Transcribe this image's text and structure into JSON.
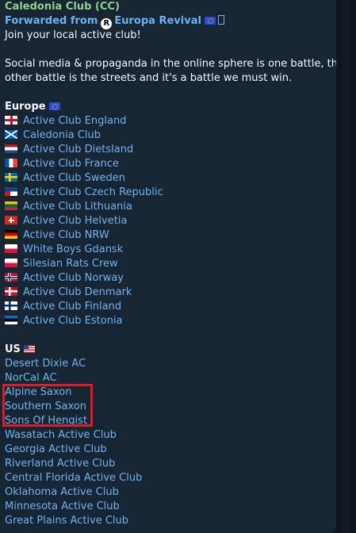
{
  "message": {
    "sender": "Caledonia Club (CC)",
    "forwarded_prefix": "Forwarded from",
    "forwarded_channel": "Europa Revival",
    "intro": "Join your local active club!",
    "paragraph_line1": "Social media & propaganda in the online sphere is one battle, the",
    "paragraph_line2": "other battle is the streets and it's a battle we must win.",
    "europe_heading": "Europe",
    "europe_clubs": [
      {
        "name": "Active Club England",
        "flag": "england-flag-icon",
        "colors": [
          "#ffffff",
          "#ce1124"
        ]
      },
      {
        "name": "Caledonia Club",
        "flag": "scotland-flag-icon",
        "colors": [
          "#005eb8",
          "#ffffff"
        ]
      },
      {
        "name": "Active Club Dietsland",
        "flag": "netherlands-flag-icon",
        "colors": [
          "#ae1c28",
          "#ffffff",
          "#21468b"
        ]
      },
      {
        "name": "Active Club France",
        "flag": "france-flag-icon",
        "colors": [
          "#0055a4",
          "#ffffff",
          "#ef4135"
        ]
      },
      {
        "name": "Active Club Sweden",
        "flag": "sweden-flag-icon",
        "colors": [
          "#006aa7",
          "#fecc00"
        ]
      },
      {
        "name": "Active Club Czech Republic",
        "flag": "czech-flag-icon",
        "colors": [
          "#ffffff",
          "#d7141a",
          "#11457e"
        ]
      },
      {
        "name": "Active Club Lithuania",
        "flag": "lithuania-flag-icon",
        "colors": [
          "#fdb913",
          "#006a44",
          "#c1272d"
        ]
      },
      {
        "name": "Active Club Helvetia",
        "flag": "switzerland-flag-icon",
        "colors": [
          "#d52b1e",
          "#ffffff"
        ]
      },
      {
        "name": "Active Club NRW",
        "flag": "germany-flag-icon",
        "colors": [
          "#000000",
          "#dd0000",
          "#ffce00"
        ]
      },
      {
        "name": "White Boys Gdansk",
        "flag": "poland-flag-icon",
        "colors": [
          "#ffffff",
          "#dc143c"
        ]
      },
      {
        "name": "Silesian Rats Crew",
        "flag": "poland-flag-icon",
        "colors": [
          "#ffffff",
          "#dc143c"
        ]
      },
      {
        "name": "Active Club Norway",
        "flag": "norway-flag-icon",
        "colors": [
          "#ba0c2f",
          "#ffffff",
          "#00205b"
        ]
      },
      {
        "name": "Active Club Denmark",
        "flag": "denmark-flag-icon",
        "colors": [
          "#c8102e",
          "#ffffff"
        ]
      },
      {
        "name": "Active Club Finland",
        "flag": "finland-flag-icon",
        "colors": [
          "#ffffff",
          "#002f6c"
        ]
      },
      {
        "name": "Active Club Estonia",
        "flag": "estonia-flag-icon",
        "colors": [
          "#0072ce",
          "#000000",
          "#ffffff"
        ]
      }
    ],
    "us_heading": "US",
    "us_clubs": [
      "Desert Dixie AC",
      "NorCal AC",
      "Alpine Saxon",
      "Southern Saxon",
      "Sons Of Hengist",
      "Wasatach Active Club",
      "Georgia Active Club",
      "Riverland Active Club",
      "Central Florida Active Club",
      "Oklahoma Active Club",
      "Minnesota Active Club",
      "Great Plains Active Club"
    ]
  },
  "colors": {
    "background": "#0e1621",
    "bubble": "#182533",
    "sender": "#8fd18a",
    "link": "#6ab3f3",
    "text": "#f5f5f5",
    "highlight": "#e01b24"
  }
}
